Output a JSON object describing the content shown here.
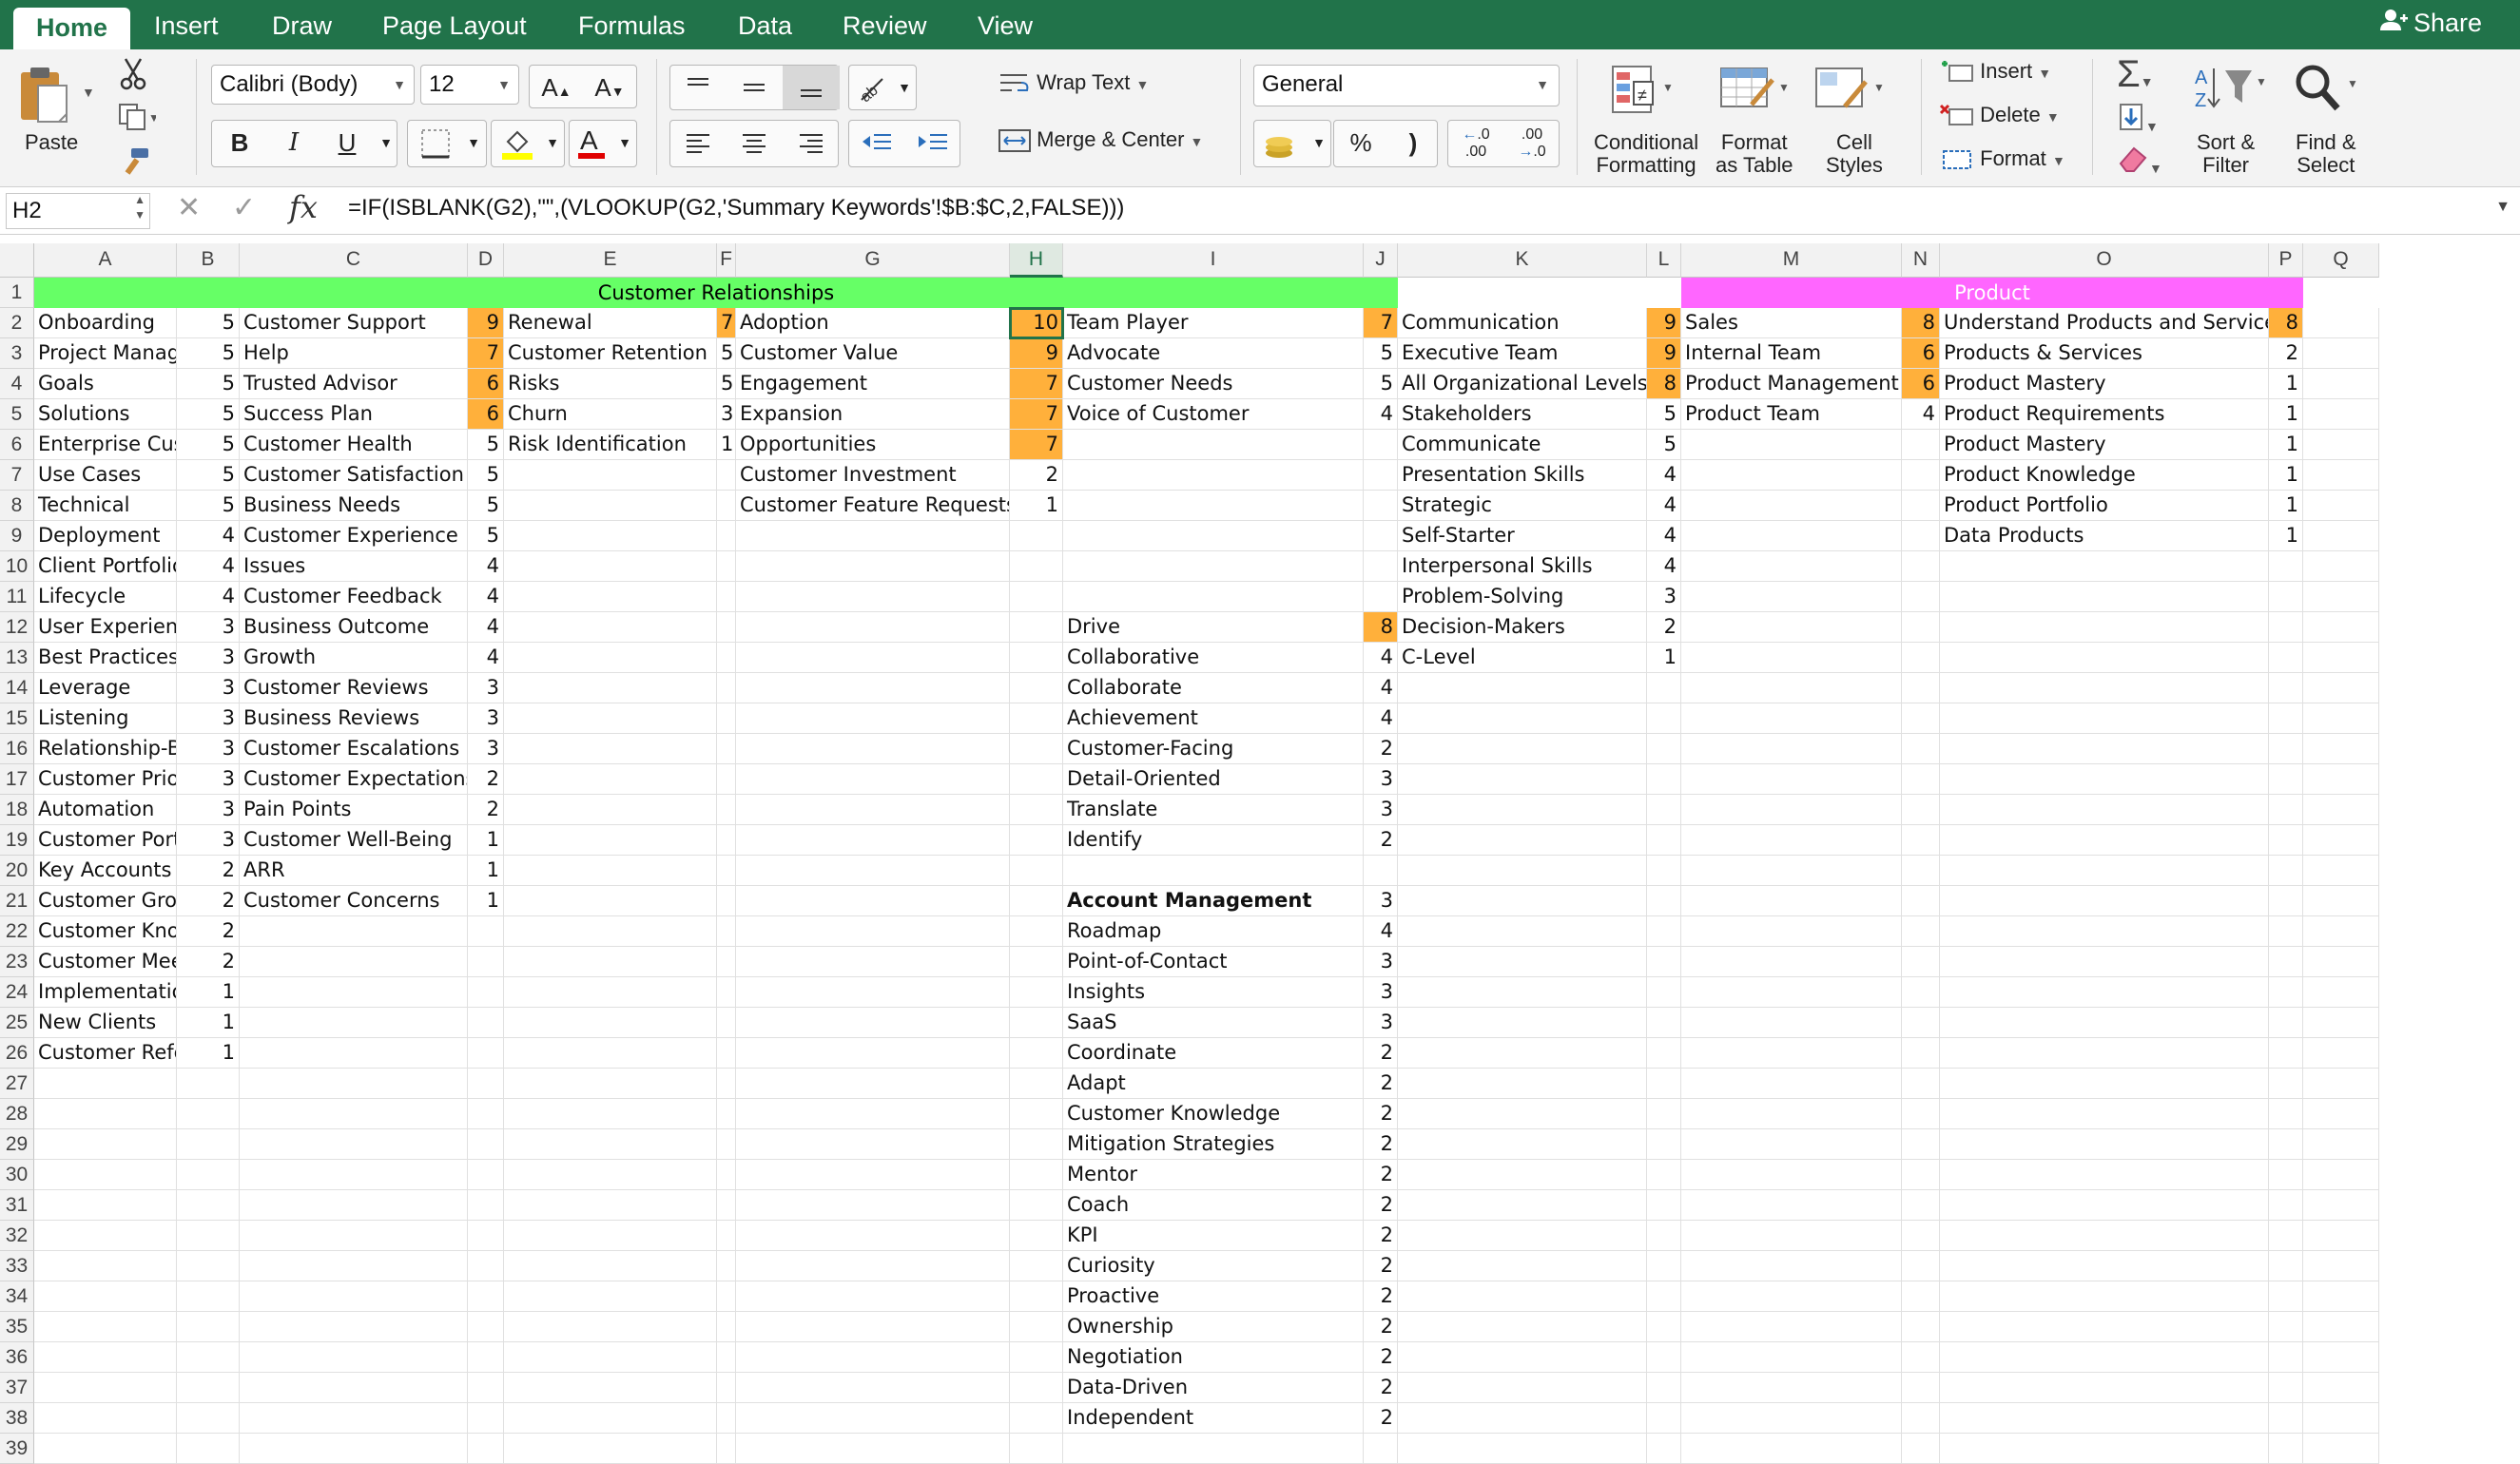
{
  "ribbon_tabs": [
    {
      "label": "Home",
      "active": true
    },
    {
      "label": "Insert"
    },
    {
      "label": "Draw"
    },
    {
      "label": "Page Layout"
    },
    {
      "label": "Formulas"
    },
    {
      "label": "Data"
    },
    {
      "label": "Review"
    },
    {
      "label": "View"
    }
  ],
  "share_label": "Share",
  "ribbon": {
    "paste_label": "Paste",
    "font_name": "Calibri (Body)",
    "font_size": "12",
    "bold": "B",
    "italic": "I",
    "underline": "U",
    "wrap_text": "Wrap Text",
    "merge_center": "Merge & Center",
    "number_format": "General",
    "percent": "%",
    "comma": ")",
    "inc_decimal": ".0\n.00",
    "dec_decimal": ".00\n→.0",
    "conditional_formatting": [
      "Conditional",
      "Formatting"
    ],
    "format_as_table": [
      "Format",
      "as Table"
    ],
    "cell_styles": [
      "Cell",
      "Styles"
    ],
    "insert": "Insert",
    "delete": "Delete",
    "format": "Format",
    "sort_filter": [
      "Sort &",
      "Filter"
    ],
    "find_select": [
      "Find &",
      "Select"
    ],
    "accent_color": "#21734a"
  },
  "formula_bar": {
    "name_box": "H2",
    "formula": "=IF(ISBLANK(G2),\"\",(VLOOKUP(G2,'Summary Keywords'!$B:$C,2,FALSE)))"
  },
  "selected_cell": "H2",
  "columns": [
    "A",
    "B",
    "C",
    "D",
    "E",
    "F",
    "G",
    "H",
    "I",
    "J",
    "K",
    "L",
    "M",
    "N",
    "O",
    "P",
    "Q"
  ],
  "headers_row1": [
    {
      "label": "Customer Relationships",
      "color": "#66ff66"
    },
    {
      "label": "Product",
      "color": "#ff66ff"
    }
  ],
  "highlight_color": "#ffb03b",
  "rows": [
    {
      "n": 1
    },
    {
      "n": 2,
      "A": "Onboarding",
      "B": "5",
      "C": "Customer Support",
      "D": "9",
      "E": "Renewal",
      "F": "7",
      "G": "Adoption",
      "H": "10",
      "I": "Team Player",
      "J": "7",
      "K": "Communication",
      "L": "9",
      "M": "Sales",
      "N": "8",
      "O": "Understand Products and Services",
      "P": "8"
    },
    {
      "n": 3,
      "A": "Project Management",
      "B": "5",
      "C": "Help",
      "D": "7",
      "E": "Customer Retention",
      "F": "5",
      "G": "Customer Value",
      "H": "9",
      "I": "Advocate",
      "J": "5",
      "K": "Executive Team",
      "L": "9",
      "M": "Internal Team",
      "N": "6",
      "O": "Products & Services",
      "P": "2"
    },
    {
      "n": 4,
      "A": "Goals",
      "B": "5",
      "C": "Trusted Advisor",
      "D": "6",
      "E": "Risks",
      "F": "5",
      "G": "Engagement",
      "H": "7",
      "I": "Customer Needs",
      "J": "5",
      "K": "All Organizational Levels",
      "L": "8",
      "M": "Product Management",
      "N": "6",
      "O": "Product Mastery",
      "P": "1"
    },
    {
      "n": 5,
      "A": "Solutions",
      "B": "5",
      "C": "Success Plan",
      "D": "6",
      "E": "Churn",
      "F": "3",
      "G": "Expansion",
      "H": "7",
      "I": "Voice of Customer",
      "J": "4",
      "K": "Stakeholders",
      "L": "5",
      "M": "Product Team",
      "N": "4",
      "O": "Product Requirements",
      "P": "1"
    },
    {
      "n": 6,
      "A": "Enterprise Customers",
      "B": "5",
      "C": "Customer Health",
      "D": "5",
      "E": "Risk Identification",
      "F": "1",
      "G": "Opportunities",
      "H": "7",
      "K": "Communicate",
      "L": "5",
      "O": "Product Mastery",
      "P": "1"
    },
    {
      "n": 7,
      "A": "Use Cases",
      "B": "5",
      "C": "Customer Satisfaction",
      "D": "5",
      "G": "Customer Investment",
      "H": "2",
      "K": "Presentation Skills",
      "L": "4",
      "O": "Product Knowledge",
      "P": "1"
    },
    {
      "n": 8,
      "A": "Technical",
      "B": "5",
      "C": "Business Needs",
      "D": "5",
      "G": "Customer Feature Requests",
      "H": "1",
      "K": "Strategic",
      "L": "4",
      "O": "Product Portfolio",
      "P": "1"
    },
    {
      "n": 9,
      "A": "Deployment",
      "B": "4",
      "C": "Customer Experience",
      "D": "5",
      "K": "Self-Starter",
      "L": "4",
      "O": "Data Products",
      "P": "1"
    },
    {
      "n": 10,
      "A": "Client Portfolio",
      "B": "4",
      "C": "Issues",
      "D": "4",
      "K": "Interpersonal Skills",
      "L": "4"
    },
    {
      "n": 11,
      "A": "Lifecycle",
      "B": "4",
      "C": "Customer Feedback",
      "D": "4",
      "K": "Problem-Solving",
      "L": "3"
    },
    {
      "n": 12,
      "A": "User Experience",
      "B": "3",
      "C": "Business Outcome",
      "D": "4",
      "I": "Drive",
      "J": "8",
      "K": "Decision-Makers",
      "L": "2"
    },
    {
      "n": 13,
      "A": "Best Practices",
      "B": "3",
      "C": "Growth",
      "D": "4",
      "I": "Collaborative",
      "J": "4",
      "K": "C-Level",
      "L": "1"
    },
    {
      "n": 14,
      "A": "Leverage",
      "B": "3",
      "C": "Customer Reviews",
      "D": "3",
      "I": "Collaborate",
      "J": "4"
    },
    {
      "n": 15,
      "A": "Listening",
      "B": "3",
      "C": "Business Reviews",
      "D": "3",
      "I": "Achievement",
      "J": "4"
    },
    {
      "n": 16,
      "A": "Relationship-Building",
      "B": "3",
      "C": "Customer Escalations",
      "D": "3",
      "I": "Customer-Facing",
      "J": "2"
    },
    {
      "n": 17,
      "A": "Customer Priorities",
      "B": "3",
      "C": "Customer Expectations",
      "D": "2",
      "I": "Detail-Oriented",
      "J": "3"
    },
    {
      "n": 18,
      "A": "Automation",
      "B": "3",
      "C": "Pain Points",
      "D": "2",
      "I": "Translate",
      "J": "3"
    },
    {
      "n": 19,
      "A": "Customer Portfolio",
      "B": "3",
      "C": "Customer Well-Being",
      "D": "1",
      "I": "Identify",
      "J": "2"
    },
    {
      "n": 20,
      "A": "Key Accounts",
      "B": "2",
      "C": "ARR",
      "D": "1"
    },
    {
      "n": 21,
      "A": "Customer Growth",
      "B": "2",
      "C": "Customer Concerns",
      "D": "1",
      "I": "Account Management",
      "J": "3"
    },
    {
      "n": 22,
      "A": "Customer Knowledge",
      "B": "2",
      "I": "Roadmap",
      "J": "4"
    },
    {
      "n": 23,
      "A": "Customer Meetings",
      "B": "2",
      "I": "Point-of-Contact",
      "J": "3"
    },
    {
      "n": 24,
      "A": "Implementation",
      "B": "1",
      "I": "Insights",
      "J": "3"
    },
    {
      "n": 25,
      "A": "New Clients",
      "B": "1",
      "I": "SaaS",
      "J": "3"
    },
    {
      "n": 26,
      "A": "Customer References",
      "B": "1",
      "I": "Coordinate",
      "J": "2"
    },
    {
      "n": 27,
      "I": "Adapt",
      "J": "2"
    },
    {
      "n": 28,
      "I": "Customer Knowledge",
      "J": "2"
    },
    {
      "n": 29,
      "I": "Mitigation Strategies",
      "J": "2"
    },
    {
      "n": 30,
      "I": "Mentor",
      "J": "2"
    },
    {
      "n": 31,
      "I": "Coach",
      "J": "2"
    },
    {
      "n": 32,
      "I": "KPI",
      "J": "2"
    },
    {
      "n": 33,
      "I": "Curiosity",
      "J": "2"
    },
    {
      "n": 34,
      "I": "Proactive",
      "J": "2"
    },
    {
      "n": 35,
      "I": "Ownership",
      "J": "2"
    },
    {
      "n": 36,
      "I": "Negotiation",
      "J": "2"
    },
    {
      "n": 37,
      "I": "Data-Driven",
      "J": "2"
    },
    {
      "n": 38,
      "I": "Independent",
      "J": "2"
    },
    {
      "n": 39
    }
  ],
  "highlighted_cells": [
    "D2",
    "D3",
    "D4",
    "D5",
    "F2",
    "H2",
    "H3",
    "H4",
    "H5",
    "H6",
    "J2",
    "J12",
    "L2",
    "L3",
    "L4",
    "N2",
    "N3",
    "N4",
    "P2"
  ],
  "bold_cells": [
    "I21"
  ]
}
